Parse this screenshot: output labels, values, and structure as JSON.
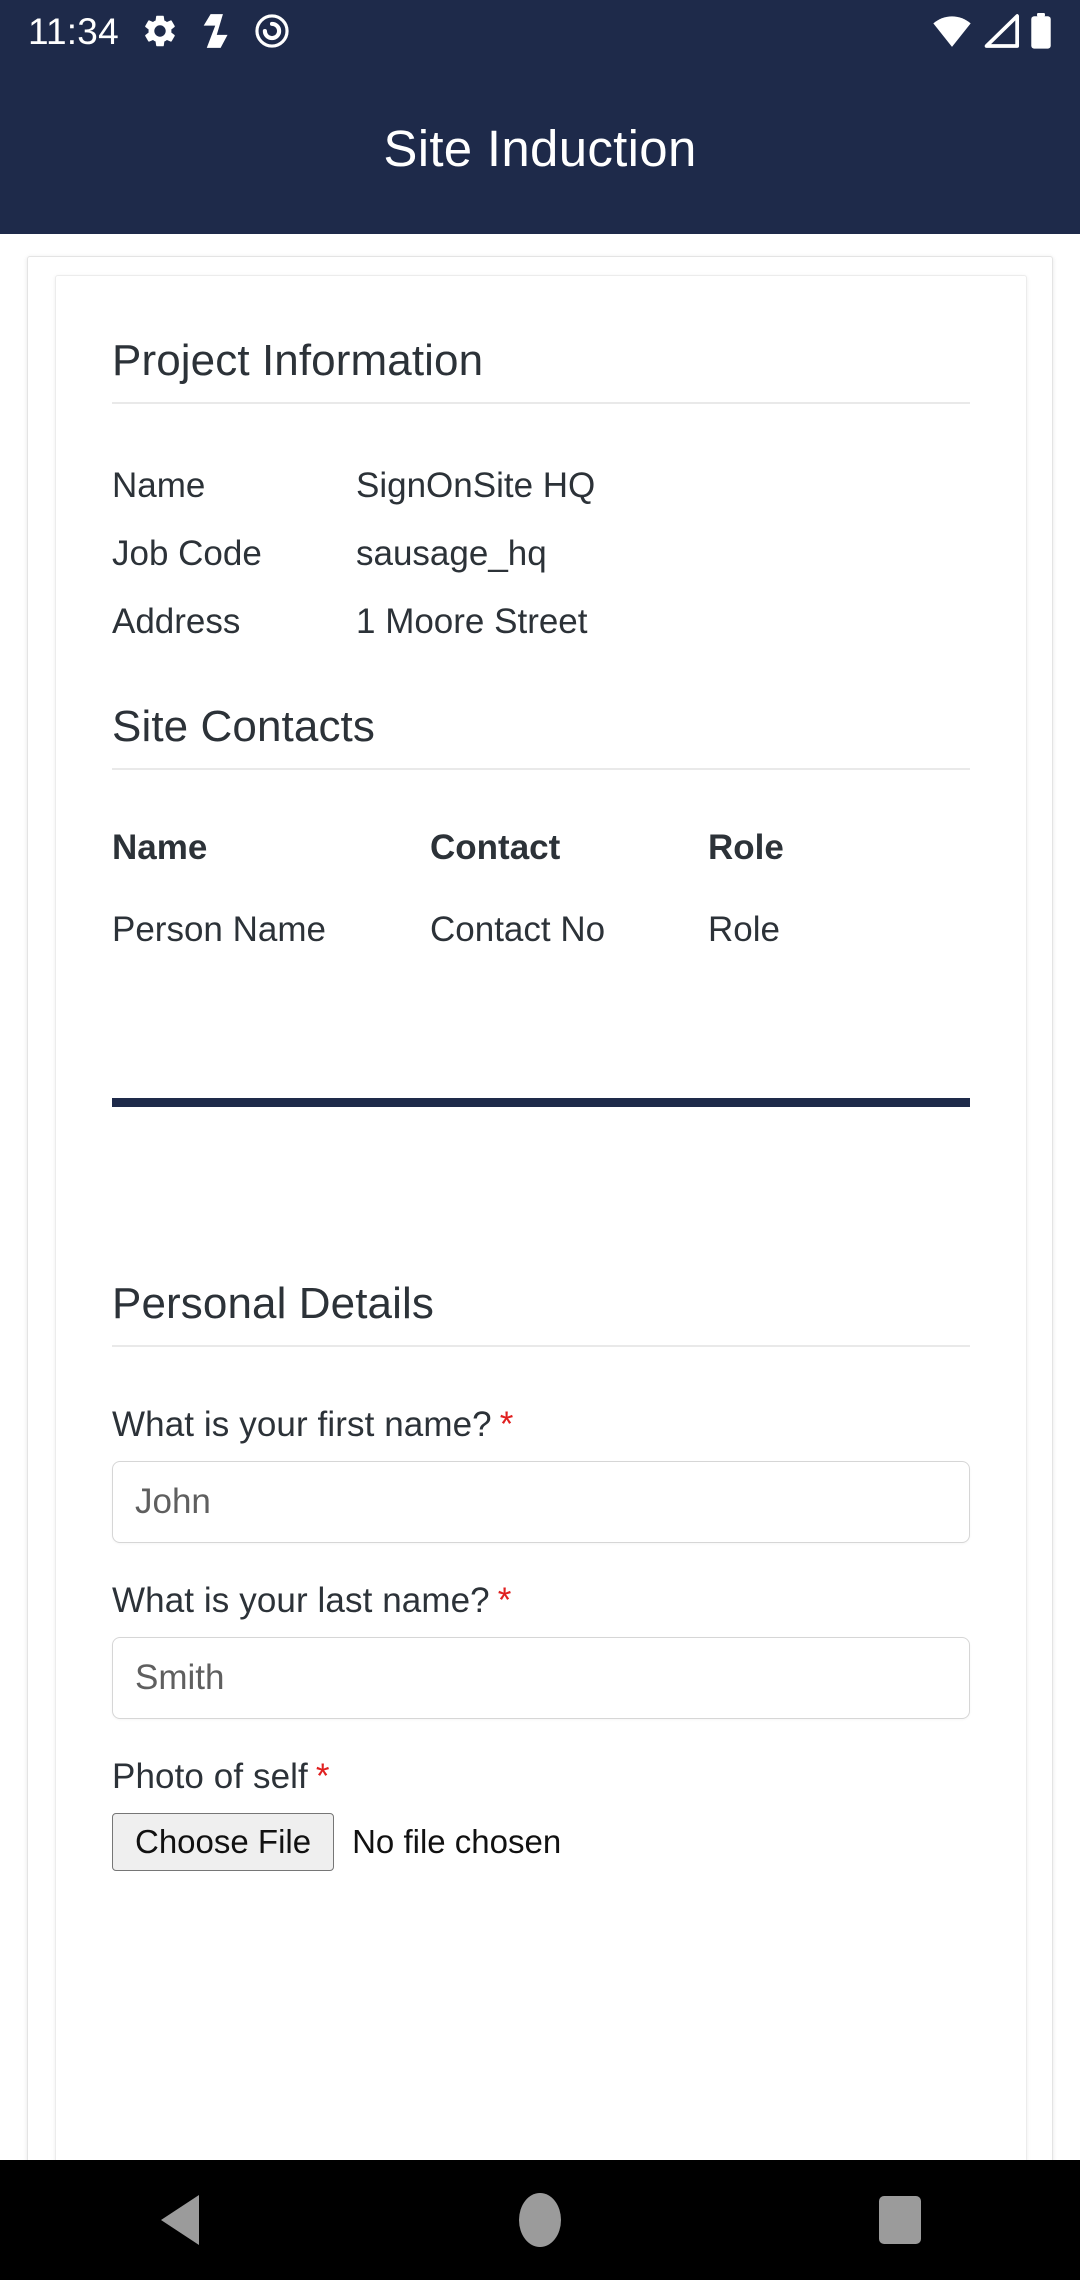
{
  "status_bar": {
    "time": "11:34",
    "left_icons": [
      "gear-icon",
      "signonsite-logo-icon",
      "record-target-icon"
    ],
    "right_icons": [
      "wifi-icon",
      "cellular-signal-icon",
      "battery-icon"
    ]
  },
  "app_bar": {
    "title": "Site Induction",
    "background_color": "#1e2a4a"
  },
  "project_information": {
    "heading": "Project Information",
    "rows": [
      {
        "label": "Name",
        "value": "SignOnSite HQ"
      },
      {
        "label": "Job Code",
        "value": "sausage_hq"
      },
      {
        "label": "Address",
        "value": "1 Moore Street"
      }
    ]
  },
  "site_contacts": {
    "heading": "Site Contacts",
    "columns": [
      "Name",
      "Contact",
      "Role"
    ],
    "rows": [
      {
        "name": "Person Name",
        "contact": "Contact No",
        "role": "Role"
      }
    ]
  },
  "divider": {
    "color": "#1e2a4a"
  },
  "personal_details": {
    "heading": "Personal Details",
    "fields": [
      {
        "label": "What is your first name?",
        "required_marker": "*",
        "type": "text",
        "placeholder": "John",
        "value": ""
      },
      {
        "label": "What is your last name?",
        "required_marker": "*",
        "type": "text",
        "placeholder": "Smith",
        "value": ""
      },
      {
        "label": "Photo of self",
        "required_marker": "*",
        "type": "file",
        "button_label": "Choose File",
        "status_text": "No file chosen"
      }
    ]
  },
  "nav_bar": {
    "buttons": [
      "back-button",
      "home-button",
      "recents-button"
    ],
    "icon_color": "#9b9b9b"
  },
  "colors": {
    "accent": "#1e2a4a",
    "required": "#e02020",
    "text": "#2c3238"
  }
}
